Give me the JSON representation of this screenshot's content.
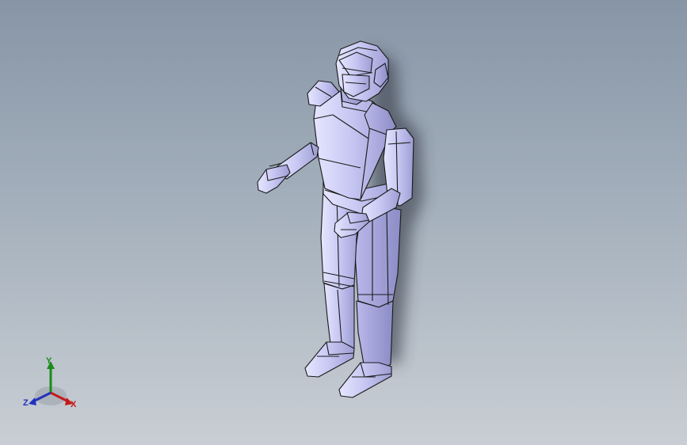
{
  "viewport": {
    "background_top": "#8795a6",
    "background_bottom": "#c9ced4",
    "model_color": "#c8c8f4",
    "model_edge": "#1a1a1a"
  },
  "triad": {
    "x_label": "X",
    "y_label": "Y",
    "z_label": "Z",
    "x_color": "#c41a1a",
    "y_color": "#1a8c1a",
    "z_color": "#2233bb"
  }
}
